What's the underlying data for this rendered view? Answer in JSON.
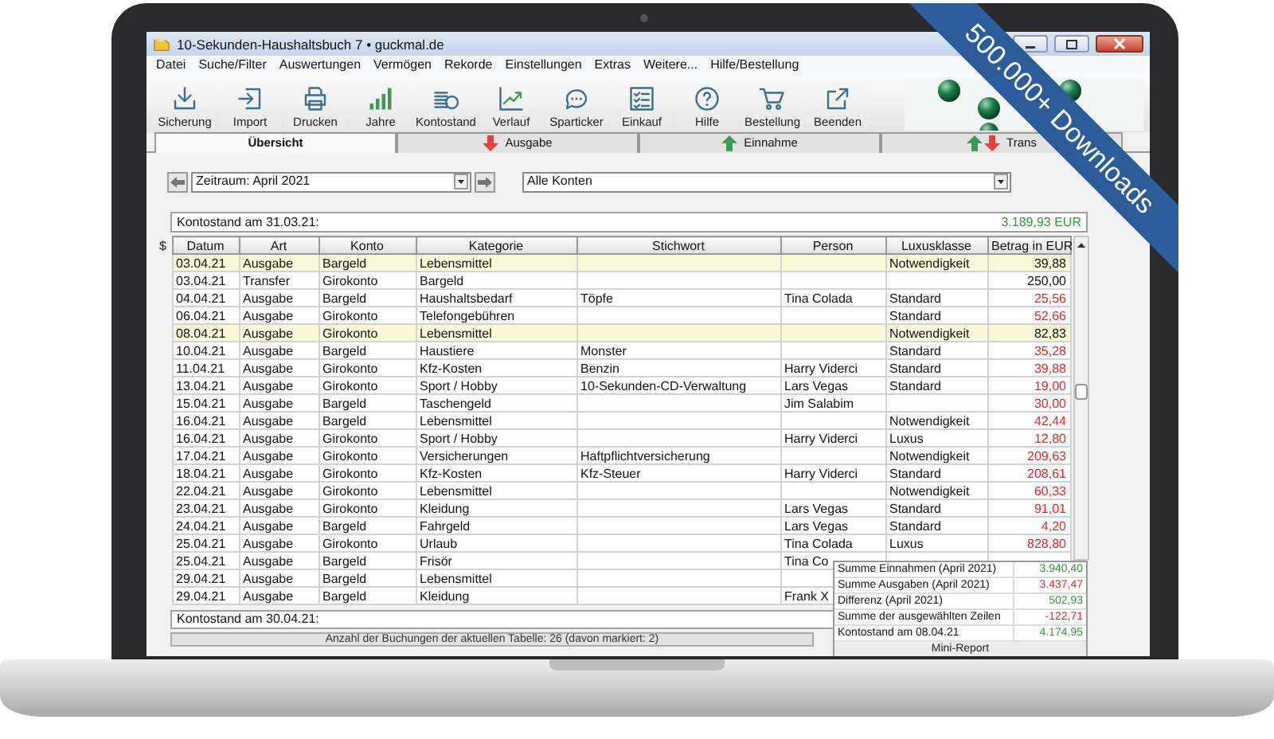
{
  "window": {
    "title": "10-Sekunden-Haushaltsbuch 7  •  guckmal.de"
  },
  "menu": [
    "Datei",
    "Suche/Filter",
    "Auswertungen",
    "Vermögen",
    "Rekorde",
    "Einstellungen",
    "Extras",
    "Weitere...",
    "Hilfe/Bestellung"
  ],
  "toolbar": [
    "Sicherung",
    "Import",
    "Drucken",
    "Jahre",
    "Kontostand",
    "Verlauf",
    "Sparticker",
    "Einkauf",
    "Hilfe",
    "Bestellung",
    "Beenden"
  ],
  "tabs": [
    {
      "label": "Übersicht",
      "selected": true
    },
    {
      "label": "Ausgabe",
      "selected": false
    },
    {
      "label": "Einnahme",
      "selected": false
    },
    {
      "label": "Trans",
      "selected": false
    }
  ],
  "filter": {
    "period": "Zeitraum: April 2021",
    "account": "Alle Konten"
  },
  "opening_balance": {
    "label": "Kontostand am 31.03.21:",
    "value": "3.189,93 EUR"
  },
  "table": {
    "sort_marker": "$",
    "columns": [
      "Datum",
      "Art",
      "Konto",
      "Kategorie",
      "Stichwort",
      "Person",
      "Luxusklasse",
      "Betrag in EUR"
    ],
    "rows": [
      {
        "date": "03.04.21",
        "type": "Ausgabe",
        "account": "Bargeld",
        "category": "Lebensmittel",
        "class": "Notwendigkeit",
        "amount": "39,88",
        "marked": true
      },
      {
        "date": "03.04.21",
        "type": "Transfer",
        "account": "Girokonto",
        "category": "Bargeld",
        "amount": "250,00",
        "kind": "transfer",
        "marked": false
      },
      {
        "date": "04.04.21",
        "type": "Ausgabe",
        "account": "Bargeld",
        "category": "Haushaltsbedarf",
        "keyword": "Töpfe",
        "person": "Tina Colada",
        "class": "Standard",
        "amount": "25,56",
        "kind": "expense",
        "marked": false
      },
      {
        "date": "06.04.21",
        "type": "Ausgabe",
        "account": "Girokonto",
        "category": "Telefongebühren",
        "class": "Standard",
        "amount": "52,66",
        "kind": "expense",
        "marked": false
      },
      {
        "date": "08.04.21",
        "type": "Ausgabe",
        "account": "Girokonto",
        "category": "Lebensmittel",
        "class": "Notwendigkeit",
        "amount": "82,83",
        "marked": true
      },
      {
        "date": "10.04.21",
        "type": "Ausgabe",
        "account": "Bargeld",
        "category": "Haustiere",
        "keyword": "Monster",
        "class": "Standard",
        "amount": "35,28",
        "kind": "expense",
        "marked": false
      },
      {
        "date": "11.04.21",
        "type": "Ausgabe",
        "account": "Girokonto",
        "category": "Kfz-Kosten",
        "keyword": "Benzin",
        "person": "Harry Viderci",
        "class": "Standard",
        "amount": "39,88",
        "kind": "expense",
        "marked": false
      },
      {
        "date": "13.04.21",
        "type": "Ausgabe",
        "account": "Girokonto",
        "category": "Sport / Hobby",
        "keyword": "10-Sekunden-CD-Verwaltung",
        "person": "Lars Vegas",
        "class": "Standard",
        "amount": "19,00",
        "kind": "expense",
        "marked": false
      },
      {
        "date": "15.04.21",
        "type": "Ausgabe",
        "account": "Bargeld",
        "category": "Taschengeld",
        "person": "Jim Salabim",
        "amount": "30,00",
        "kind": "expense",
        "marked": false
      },
      {
        "date": "16.04.21",
        "type": "Ausgabe",
        "account": "Bargeld",
        "category": "Lebensmittel",
        "class": "Notwendigkeit",
        "amount": "42,44",
        "kind": "expense",
        "marked": false
      },
      {
        "date": "16.04.21",
        "type": "Ausgabe",
        "account": "Girokonto",
        "category": "Sport / Hobby",
        "person": "Harry Viderci",
        "class": "Luxus",
        "amount": "12,80",
        "kind": "expense",
        "marked": false
      },
      {
        "date": "17.04.21",
        "type": "Ausgabe",
        "account": "Girokonto",
        "category": "Versicherungen",
        "keyword": "Haftpflichtversicherung",
        "class": "Notwendigkeit",
        "amount": "209,63",
        "kind": "expense",
        "marked": false
      },
      {
        "date": "18.04.21",
        "type": "Ausgabe",
        "account": "Girokonto",
        "category": "Kfz-Kosten",
        "keyword": "Kfz-Steuer",
        "person": "Harry Viderci",
        "class": "Standard",
        "amount": "208,61",
        "kind": "expense",
        "marked": false
      },
      {
        "date": "22.04.21",
        "type": "Ausgabe",
        "account": "Girokonto",
        "category": "Lebensmittel",
        "class": "Notwendigkeit",
        "amount": "60,33",
        "kind": "expense",
        "marked": false
      },
      {
        "date": "23.04.21",
        "type": "Ausgabe",
        "account": "Girokonto",
        "category": "Kleidung",
        "person": "Lars Vegas",
        "class": "Standard",
        "amount": "91,01",
        "kind": "expense",
        "marked": false
      },
      {
        "date": "24.04.21",
        "type": "Ausgabe",
        "account": "Bargeld",
        "category": "Fahrgeld",
        "person": "Lars Vegas",
        "class": "Standard",
        "amount": "4,20",
        "kind": "expense",
        "marked": false
      },
      {
        "date": "25.04.21",
        "type": "Ausgabe",
        "account": "Girokonto",
        "category": "Urlaub",
        "person": "Tina Colada",
        "class": "Luxus",
        "amount": "828,80",
        "kind": "expense",
        "marked": false
      },
      {
        "date": "25.04.21",
        "type": "Ausgabe",
        "account": "Bargeld",
        "category": "Frisör",
        "person": "Tina Co",
        "marked": false
      },
      {
        "date": "29.04.21",
        "type": "Ausgabe",
        "account": "Bargeld",
        "category": "Lebensmittel",
        "marked": false
      },
      {
        "date": "29.04.21",
        "type": "Ausgabe",
        "account": "Bargeld",
        "category": "Kleidung",
        "person": "Frank X",
        "marked": false
      }
    ]
  },
  "closing_balance": {
    "label": "Kontostand am 30.04.21:"
  },
  "status": "Anzahl der Buchungen der aktuellen Tabelle: 26 (davon markiert:  2)",
  "mini_report": {
    "title": "Mini-Report",
    "rows": [
      {
        "label": "Summe Einnahmen (April 2021)",
        "value": "3.940,40",
        "color": "#2e9a3c"
      },
      {
        "label": "Summe Ausgaben (April 2021)",
        "value": "3.437,47",
        "color": "#e5262b"
      },
      {
        "label": "Differenz (April 2021)",
        "value": "502,93",
        "color": "#2e9a3c"
      },
      {
        "label": "Summe der ausgewählten Zeilen",
        "value": "-122,71",
        "color": "#e5262b"
      },
      {
        "label": "Kontostand am 08.04.21",
        "value": "4.174,95",
        "color": "#2e9a3c"
      }
    ]
  },
  "ribbon": {
    "text": "500.000+ Downloads"
  }
}
